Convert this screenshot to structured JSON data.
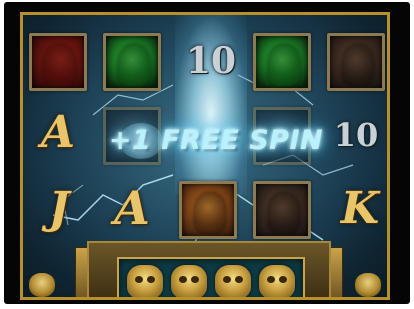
{
  "banner": {
    "text": "+1 FREE SPIN"
  },
  "symbols": {
    "top_number": "10",
    "right_number": "10",
    "ace_left": "A",
    "jack": "J",
    "ace_bottom": "A",
    "king": "K"
  },
  "tiles": [
    "red-demon",
    "green-warrior",
    "green-warrior",
    "dark-knight",
    "fire-beast",
    "dark-knight"
  ],
  "bonus_tray": {
    "slots": 4,
    "icon": "gold-skull"
  },
  "colors": {
    "gold": "#e8c46a",
    "frame_gold": "#b8902a",
    "glow": "#b8f2ff",
    "background": "#20475c"
  }
}
